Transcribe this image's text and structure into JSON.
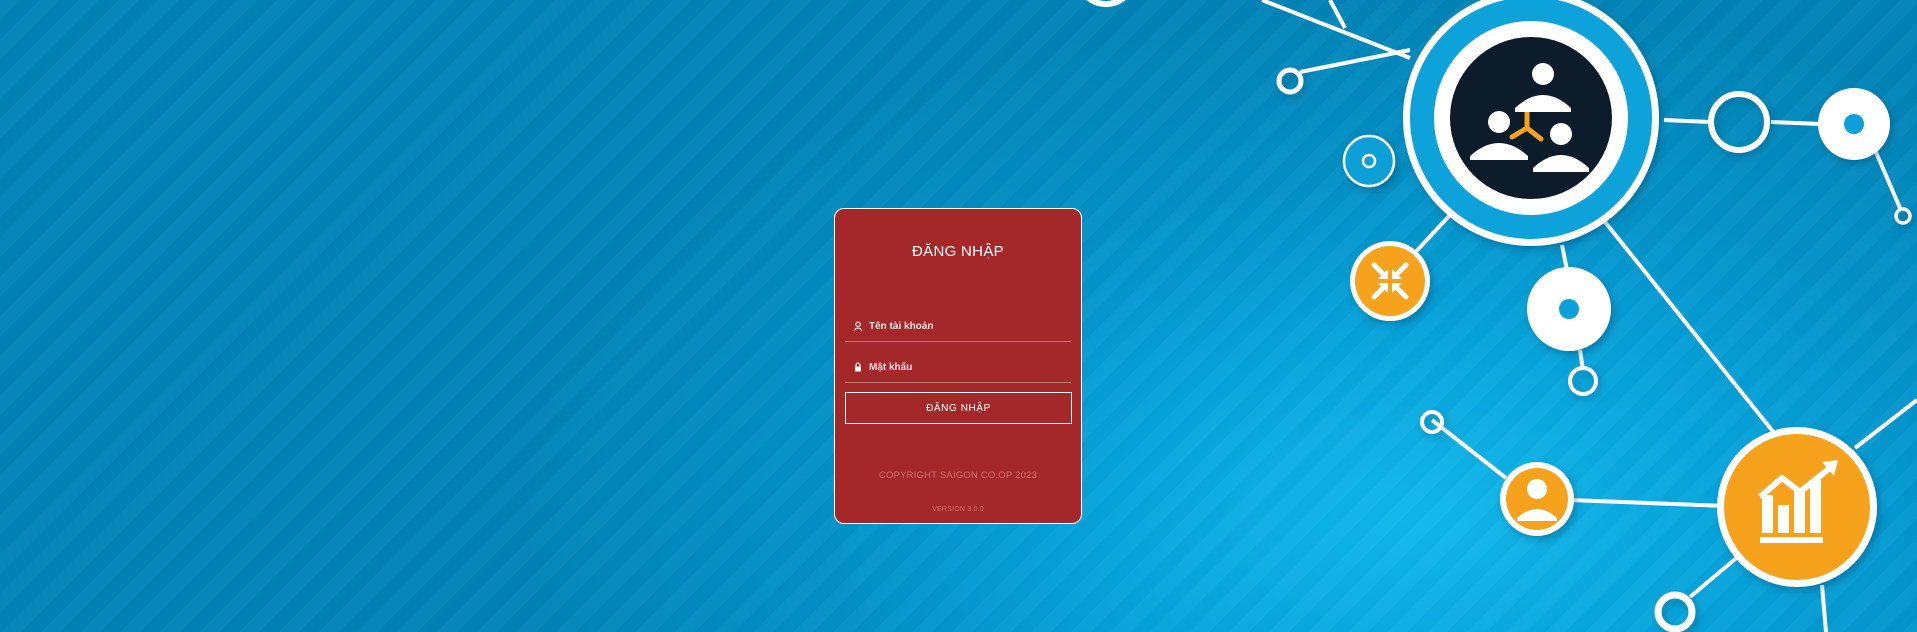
{
  "login": {
    "title": "ĐĂNG NHẬP",
    "username_placeholder": "Tên tài khoản",
    "password_placeholder": "Mật khẩu",
    "submit_label": "ĐĂNG NHẬP",
    "copyright": "COPYRIGHT SAIGON CO.OP 2023",
    "version": "VERSION 3.0.0"
  },
  "colors": {
    "background": "#0392c8",
    "card": "#a4282a",
    "accent_orange": "#f6a21e",
    "node_dark": "#0f1a2a",
    "node_white": "#ffffff"
  },
  "icons": {
    "username": "user-icon",
    "password": "lock-icon",
    "hub": "team-network-icon",
    "collapse": "compress-arrows-icon",
    "person": "person-icon",
    "growth": "growth-chart-icon"
  }
}
